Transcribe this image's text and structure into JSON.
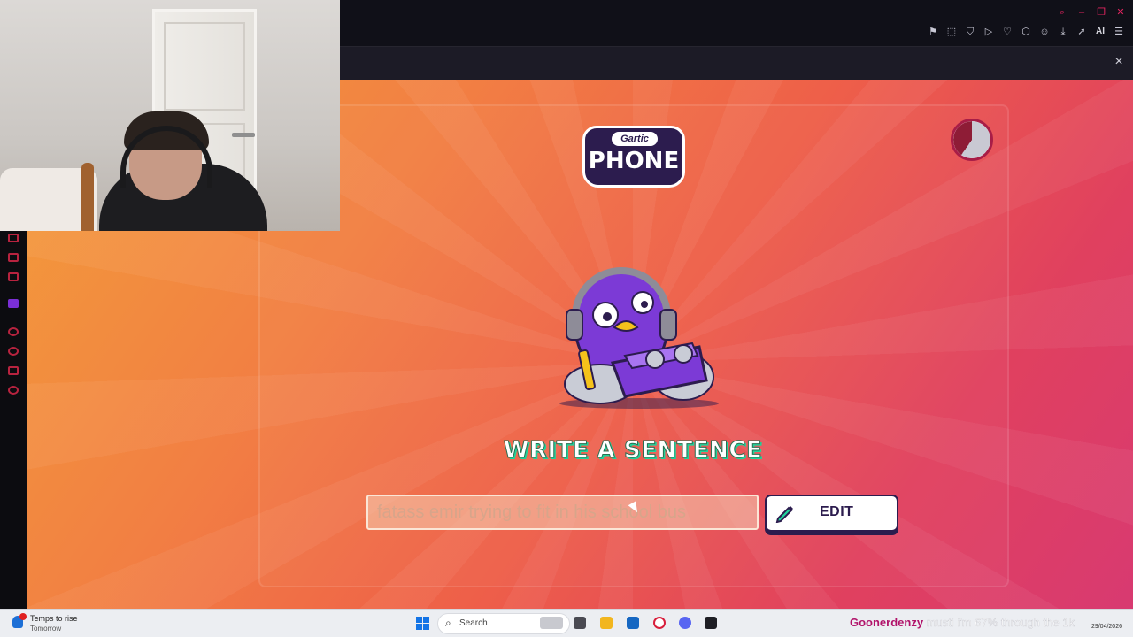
{
  "browser": {
    "toolbar_icons": [
      "bookmark-icon",
      "screenshot-icon",
      "shield-icon",
      "play-icon",
      "heart-icon",
      "cube-icon",
      "profile-icon",
      "download-icon",
      "send-icon",
      "menu-icon"
    ],
    "ai_label": "AI",
    "window_controls": [
      "search-icon",
      "minimize-icon",
      "restore-icon",
      "close-icon"
    ],
    "close_panel_glyph": "×"
  },
  "game": {
    "logo": {
      "top": "Gartic",
      "main": "PHONE"
    },
    "prompt": "WRITE A SENTENCE",
    "sentence_value": "fatass emir trying to fit in his school bus",
    "edit_label": "EDIT",
    "colors": {
      "bg_start": "#f39d3a",
      "bg_end": "#d83a71",
      "dark": "#2c1c4e",
      "accent": "#20d29a"
    }
  },
  "taskbar": {
    "weather_title": "Temps to rise",
    "weather_sub": "Tomorrow",
    "search_label": "Search",
    "chat_user": "Goonerdenzy",
    "chat_message": "musti i'm 67% through the 1k",
    "clock_date": "29/04/2026"
  }
}
